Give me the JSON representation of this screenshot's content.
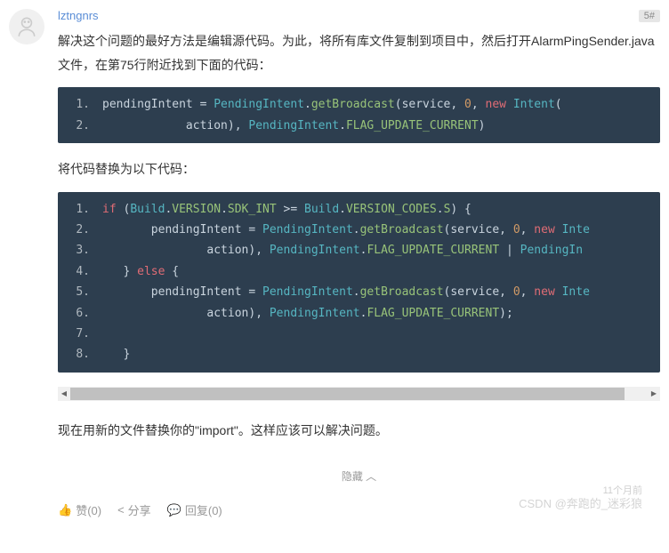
{
  "post": {
    "username": "lztngnrs",
    "floor": "5#",
    "paragraph1": "解决这个问题的最好方法是编辑源代码。为此，将所有库文件复制到项目中，然后打开AlarmPingSender.java文件，在第75行附近找到下面的代码：",
    "paragraph2": "将代码替换为以下代码：",
    "paragraph3": "现在用新的文件替换你的\"import\"。这样应该可以解决问题。"
  },
  "code1": {
    "lines": [
      "1.",
      "2."
    ],
    "tokens": [
      [
        {
          "c": "t-default",
          "t": "pendingIntent "
        },
        {
          "c": "t-op",
          "t": "="
        },
        {
          "c": "t-default",
          "t": " "
        },
        {
          "c": "t-class",
          "t": "PendingIntent"
        },
        {
          "c": "t-op",
          "t": "."
        },
        {
          "c": "t-method",
          "t": "getBroadcast"
        },
        {
          "c": "t-paren",
          "t": "("
        },
        {
          "c": "t-default",
          "t": "service"
        },
        {
          "c": "t-paren",
          "t": ","
        },
        {
          "c": "t-default",
          "t": " "
        },
        {
          "c": "t-num",
          "t": "0"
        },
        {
          "c": "t-paren",
          "t": ","
        },
        {
          "c": "t-default",
          "t": " "
        },
        {
          "c": "t-kw",
          "t": "new"
        },
        {
          "c": "t-default",
          "t": " "
        },
        {
          "c": "t-class",
          "t": "Intent"
        },
        {
          "c": "t-paren",
          "t": "("
        }
      ],
      [
        {
          "c": "t-default",
          "t": "            action"
        },
        {
          "c": "t-paren",
          "t": ")"
        },
        {
          "c": "t-paren",
          "t": ","
        },
        {
          "c": "t-default",
          "t": " "
        },
        {
          "c": "t-class",
          "t": "PendingIntent"
        },
        {
          "c": "t-op",
          "t": "."
        },
        {
          "c": "t-const",
          "t": "FLAG_UPDATE_CURRENT"
        },
        {
          "c": "t-paren",
          "t": ")"
        }
      ]
    ]
  },
  "code2": {
    "lines": [
      "1.",
      "2.",
      "3.",
      "4.",
      "5.",
      "6.",
      "7.",
      "8."
    ],
    "tokens": [
      [
        {
          "c": "t-kw",
          "t": "if"
        },
        {
          "c": "t-default",
          "t": " "
        },
        {
          "c": "t-paren",
          "t": "("
        },
        {
          "c": "t-class",
          "t": "Build"
        },
        {
          "c": "t-op",
          "t": "."
        },
        {
          "c": "t-const",
          "t": "VERSION"
        },
        {
          "c": "t-op",
          "t": "."
        },
        {
          "c": "t-const",
          "t": "SDK_INT"
        },
        {
          "c": "t-default",
          "t": " "
        },
        {
          "c": "t-op",
          "t": ">="
        },
        {
          "c": "t-default",
          "t": " "
        },
        {
          "c": "t-class",
          "t": "Build"
        },
        {
          "c": "t-op",
          "t": "."
        },
        {
          "c": "t-const",
          "t": "VERSION_CODES"
        },
        {
          "c": "t-op",
          "t": "."
        },
        {
          "c": "t-const",
          "t": "S"
        },
        {
          "c": "t-paren",
          "t": ")"
        },
        {
          "c": "t-default",
          "t": " "
        },
        {
          "c": "t-paren",
          "t": "{"
        }
      ],
      [
        {
          "c": "t-default",
          "t": "       pendingIntent "
        },
        {
          "c": "t-op",
          "t": "="
        },
        {
          "c": "t-default",
          "t": " "
        },
        {
          "c": "t-class",
          "t": "PendingIntent"
        },
        {
          "c": "t-op",
          "t": "."
        },
        {
          "c": "t-method",
          "t": "getBroadcast"
        },
        {
          "c": "t-paren",
          "t": "("
        },
        {
          "c": "t-default",
          "t": "service"
        },
        {
          "c": "t-paren",
          "t": ","
        },
        {
          "c": "t-default",
          "t": " "
        },
        {
          "c": "t-num",
          "t": "0"
        },
        {
          "c": "t-paren",
          "t": ","
        },
        {
          "c": "t-default",
          "t": " "
        },
        {
          "c": "t-kw",
          "t": "new"
        },
        {
          "c": "t-default",
          "t": " "
        },
        {
          "c": "t-class",
          "t": "Inte"
        }
      ],
      [
        {
          "c": "t-default",
          "t": "               action"
        },
        {
          "c": "t-paren",
          "t": ")"
        },
        {
          "c": "t-paren",
          "t": ","
        },
        {
          "c": "t-default",
          "t": " "
        },
        {
          "c": "t-class",
          "t": "PendingIntent"
        },
        {
          "c": "t-op",
          "t": "."
        },
        {
          "c": "t-const",
          "t": "FLAG_UPDATE_CURRENT"
        },
        {
          "c": "t-default",
          "t": " "
        },
        {
          "c": "t-op",
          "t": "|"
        },
        {
          "c": "t-default",
          "t": " "
        },
        {
          "c": "t-class",
          "t": "PendingIn"
        }
      ],
      [
        {
          "c": "t-default",
          "t": "   "
        },
        {
          "c": "t-paren",
          "t": "}"
        },
        {
          "c": "t-default",
          "t": " "
        },
        {
          "c": "t-kw",
          "t": "else"
        },
        {
          "c": "t-default",
          "t": " "
        },
        {
          "c": "t-paren",
          "t": "{"
        }
      ],
      [
        {
          "c": "t-default",
          "t": "       pendingIntent "
        },
        {
          "c": "t-op",
          "t": "="
        },
        {
          "c": "t-default",
          "t": " "
        },
        {
          "c": "t-class",
          "t": "PendingIntent"
        },
        {
          "c": "t-op",
          "t": "."
        },
        {
          "c": "t-method",
          "t": "getBroadcast"
        },
        {
          "c": "t-paren",
          "t": "("
        },
        {
          "c": "t-default",
          "t": "service"
        },
        {
          "c": "t-paren",
          "t": ","
        },
        {
          "c": "t-default",
          "t": " "
        },
        {
          "c": "t-num",
          "t": "0"
        },
        {
          "c": "t-paren",
          "t": ","
        },
        {
          "c": "t-default",
          "t": " "
        },
        {
          "c": "t-kw",
          "t": "new"
        },
        {
          "c": "t-default",
          "t": " "
        },
        {
          "c": "t-class",
          "t": "Inte"
        }
      ],
      [
        {
          "c": "t-default",
          "t": "               action"
        },
        {
          "c": "t-paren",
          "t": ")"
        },
        {
          "c": "t-paren",
          "t": ","
        },
        {
          "c": "t-default",
          "t": " "
        },
        {
          "c": "t-class",
          "t": "PendingIntent"
        },
        {
          "c": "t-op",
          "t": "."
        },
        {
          "c": "t-const",
          "t": "FLAG_UPDATE_CURRENT"
        },
        {
          "c": "t-paren",
          "t": ")"
        },
        {
          "c": "t-paren",
          "t": ";"
        }
      ],
      [
        {
          "c": "t-default",
          "t": " "
        }
      ],
      [
        {
          "c": "t-default",
          "t": "   "
        },
        {
          "c": "t-paren",
          "t": "}"
        }
      ]
    ]
  },
  "hide": "隐藏 ︿",
  "actions": {
    "like": "赞(0)",
    "share": "分享",
    "reply": "回复(0)"
  },
  "timestamp": "11个月前",
  "watermark": "CSDN @奔跑的_迷彩狼"
}
